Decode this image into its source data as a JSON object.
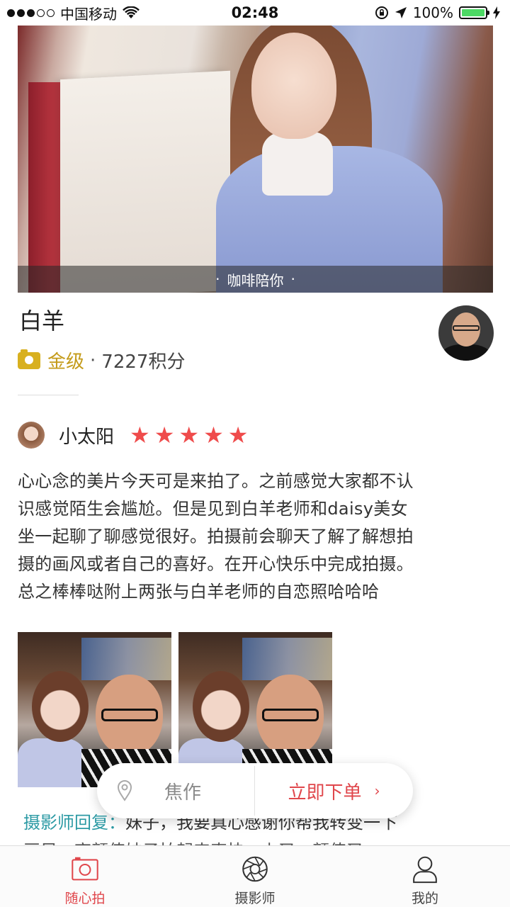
{
  "status_bar": {
    "carrier": "中国移动",
    "time": "02:48",
    "battery": "100%",
    "battery_level": 1.0,
    "signal_bars_filled": 3,
    "signal_bars_total": 5
  },
  "hero": {
    "caption": "咖啡陪你",
    "caption_dot": "·"
  },
  "profile": {
    "name": "白羊",
    "level": "金级",
    "separator": "·",
    "points": "7227积分"
  },
  "review": {
    "reviewer": "小太阳",
    "rating": 5,
    "stars": [
      "★",
      "★",
      "★",
      "★",
      "★"
    ],
    "lines": [
      "心心念的美片今天可是来拍了。之前感觉大家都不认",
      "识感觉陌生会尴尬。但是见到白羊老师和daisy美女",
      "坐一起聊了聊感觉很好。拍摄前会聊天了解了解想拍",
      "摄的画风或者自己的喜好。在开心快乐中完成拍摄。",
      "总之棒棒哒附上两张与白羊老师的自恋照哈哈哈"
    ]
  },
  "reply": {
    "label": "摄影师回复：",
    "text": "妹子，我要真心感谢你帮我转变一下",
    "line2": "画风，高颜值妹子拍起来真快，上又一颜值又"
  },
  "float_bar": {
    "works_label": "焦作",
    "order_label": "立即下单",
    "chevron": "›"
  },
  "tabs": [
    {
      "label": "随心拍",
      "active": true
    },
    {
      "label": "摄影师",
      "active": false
    },
    {
      "label": "我的",
      "active": false
    }
  ],
  "colors": {
    "accent": "#e0474c",
    "star": "#ef4b4b",
    "gold": "#c49b1a",
    "reply_label": "#2c9aa4"
  }
}
